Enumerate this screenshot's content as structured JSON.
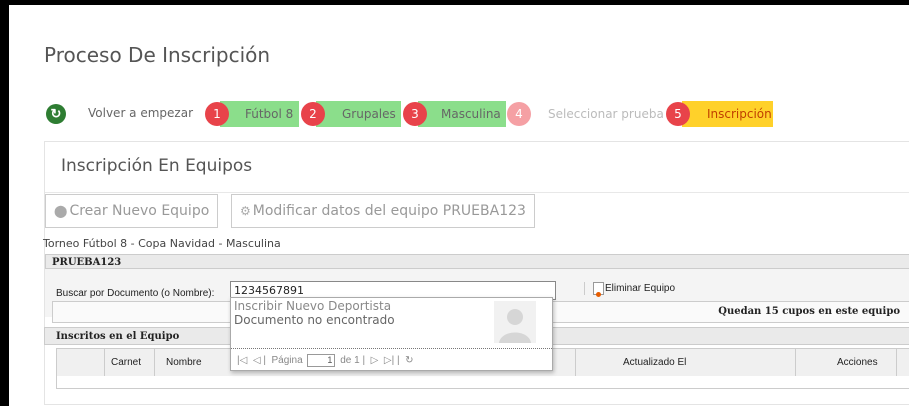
{
  "page": {
    "title": "Proceso De Inscripción"
  },
  "steps": {
    "restart_label": "Volver a empezar",
    "items": [
      {
        "num": "1",
        "label": "Fútbol 8"
      },
      {
        "num": "2",
        "label": "Grupales"
      },
      {
        "num": "3",
        "label": "Masculina"
      },
      {
        "num": "4",
        "label": "Seleccionar prueba"
      },
      {
        "num": "5",
        "label": "Inscripción"
      }
    ]
  },
  "panel": {
    "title": "Inscripción En Equipos",
    "create_team_label": "Crear Nuevo Equipo",
    "modify_team_label": "Modificar datos del equipo PRUEBA123",
    "tournament_info": "Torneo Fútbol 8 - Copa Navidad - Masculina",
    "team_name": "PRUEBA123"
  },
  "search": {
    "label": "Buscar por Documento (o Nombre):",
    "value": "1234567891"
  },
  "delete_team_label": "Eliminar Equipo",
  "cupos_text": "Quedan 15 cupos en este equipo",
  "enrolled": {
    "title": "Inscritos en el Equipo",
    "columns": [
      "Carnet",
      "Nombre",
      "Actualizado El",
      "Acciones"
    ]
  },
  "dropdown": {
    "line1": "Inscribir Nuevo Deportista",
    "line2": "Documento no encontrado",
    "pager_label": "Página",
    "pager_value": "1",
    "pager_of": "de 1"
  },
  "colors": {
    "step_done": "#8bde8b",
    "step_current": "#ffd12a",
    "step_num_red": "#e8434a",
    "step_num_disabled": "#f5a0a4",
    "restart_green": "#2e7d32"
  }
}
